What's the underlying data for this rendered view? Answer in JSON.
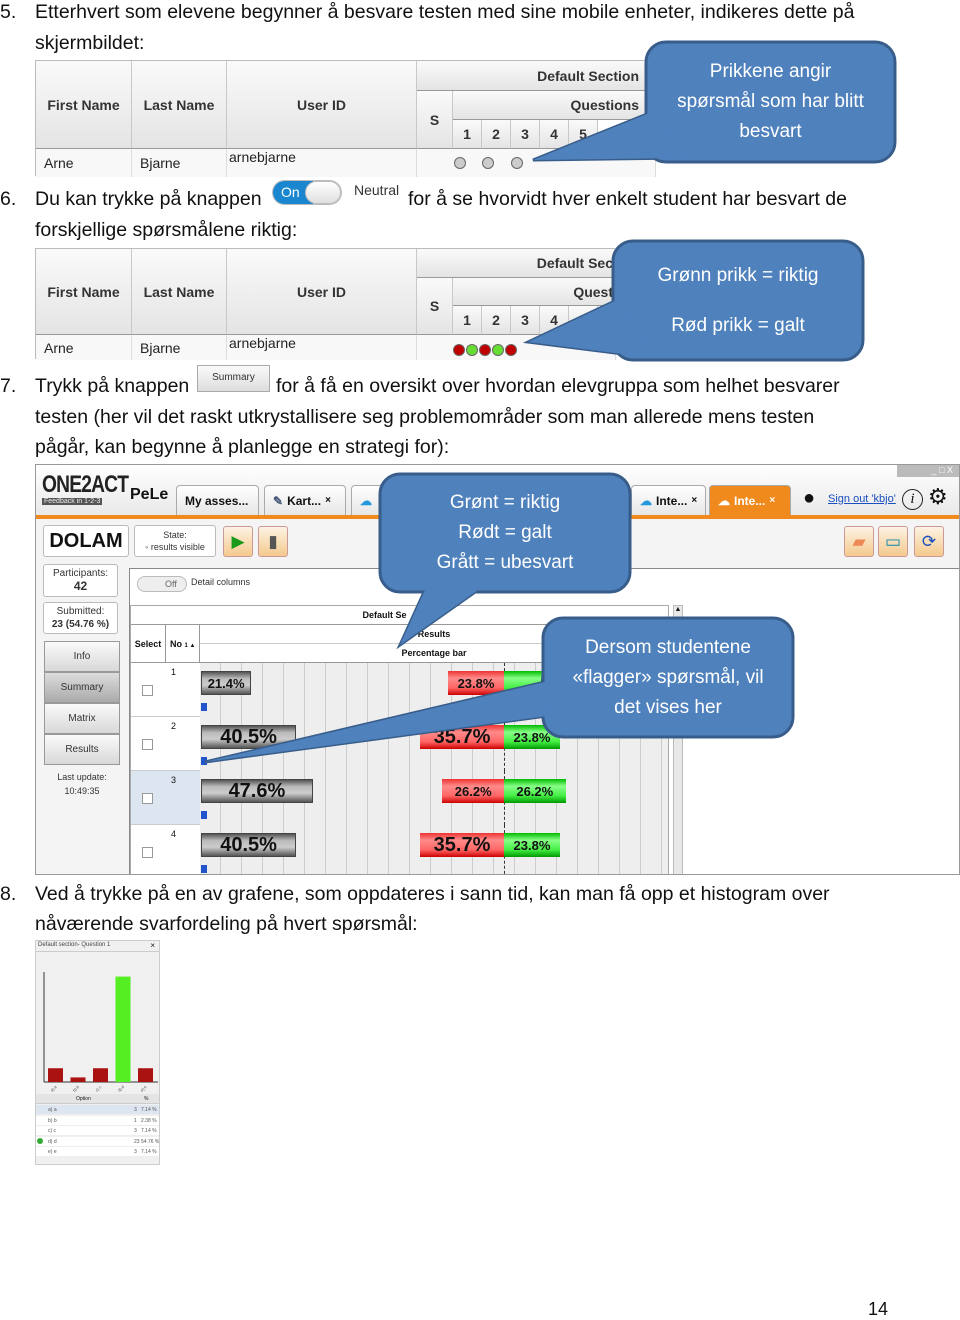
{
  "items": [
    {
      "number": "5.",
      "lines": [
        "Etterhvert som elevene begynner å besvare testen med sine mobile enheter, indikeres dette på",
        "skjermbildet:"
      ]
    },
    {
      "number": "6.",
      "lines": [
        "Du kan trykke på knappen",
        "for å se hvorvidt hver enkelt student har besvart de",
        "forskjellige spørsmålene riktig:"
      ],
      "toggle_on": "On",
      "toggle_neutral": "Neutral"
    },
    {
      "number": "7.",
      "lines": [
        "Trykk på knappen",
        "for å få en oversikt over hvordan elevgruppa som helhet besvarer",
        "testen (her vil det raskt utkrystallisere seg problemområder som man allerede mens testen",
        "pågår, kan begynne å planlegge en strategi for):"
      ],
      "button_label": "Summary"
    },
    {
      "number": "8.",
      "lines": [
        "Ved å trykke på en av grafene, som oppdateres i sann tid, kan man få opp et histogram over",
        "nåværende svarfordeling på hvert spørsmål:"
      ]
    }
  ],
  "student_table": {
    "headers": {
      "first_name": "First Name",
      "last_name": "Last Name",
      "user_id": "User ID",
      "section": "Default Section",
      "section_clipped": "Default Sec",
      "s": "S",
      "questions": "Questions",
      "questions_clipped": "Quest"
    },
    "question_numbers": [
      "1",
      "2",
      "3",
      "4",
      "5"
    ],
    "row": {
      "first_name": "Arne",
      "last_name": "Bjarne",
      "user_id": "arnebjarne"
    },
    "dots_neutral": [
      "answered",
      "answered",
      "answered"
    ],
    "dots_graded": [
      "wrong",
      "right",
      "wrong",
      "right",
      "wrong"
    ]
  },
  "callouts": {
    "c1": [
      "Prikkene angir",
      "spørsmål som har blitt",
      "besvart"
    ],
    "c2": [
      "Grønn prikk = riktig",
      "Rød prikk = galt"
    ],
    "c3": [
      "Grønt = riktig",
      "Rødt = galt",
      "Grått = ubesvart"
    ],
    "c4": [
      "Dersom studentene",
      "«flagger» spørsmål, vil",
      "det vises her"
    ]
  },
  "app": {
    "logo": "ONE2ACT",
    "logo_tagline": "Feedback in 1-2-3",
    "logo_pele": "PeLe",
    "tabs": [
      {
        "label": "My asses..."
      },
      {
        "label": "Kart...",
        "icon": "edit-icon"
      },
      {
        "label": "",
        "icon": "cloud-icon"
      },
      {
        "label": "Inte...",
        "icon": "cloud-icon"
      },
      {
        "label": "Inte...",
        "icon": "cloud-icon",
        "active": true
      }
    ],
    "sign_out": "Sign out 'kbjo'",
    "test_name": "DOLAM",
    "state_label": "State:",
    "state_value": "results visible",
    "participants_label": "Participants:",
    "participants": "42",
    "submitted_label": "Submitted:",
    "submitted": "23 (54.76 %)",
    "nav": [
      "Info",
      "Summary",
      "Matrix",
      "Results"
    ],
    "last_update_label": "Last update:",
    "last_update": "10:49:35",
    "detail_toggle": "Off",
    "detail_columns": "Detail columns",
    "grid": {
      "section": "Default Se",
      "results": "Results",
      "percentage_bar": "Percentage bar",
      "select": "Select",
      "no": "No",
      "sort": "1 ▲",
      "rows": [
        {
          "no": "1",
          "unanswered": "21.4%",
          "wrong": "23.8%",
          "right": "54.8%",
          "u": 21.4,
          "w": 23.8,
          "r": 54.8
        },
        {
          "no": "2",
          "unanswered": "40.5%",
          "wrong": "35.7%",
          "right": "23.8%",
          "u": 40.5,
          "w": 35.7,
          "r": 23.8
        },
        {
          "no": "3",
          "unanswered": "47.6%",
          "wrong": "26.2%",
          "right": "26.2%",
          "u": 47.6,
          "w": 26.2,
          "r": 26.2,
          "selected": true
        },
        {
          "no": "4",
          "unanswered": "40.5%",
          "wrong": "35.7%",
          "right": "23.8%",
          "u": 40.5,
          "w": 35.7,
          "r": 23.8
        }
      ]
    },
    "colors": {
      "accent": "#f08a1c",
      "callout": "#4f81bd",
      "right": "#22cc22",
      "wrong": "#ee3333",
      "unanswered": "#888888"
    }
  },
  "histogram": {
    "title": "Default section- Question 1",
    "close": "×",
    "columns": [
      "Option",
      "%"
    ],
    "rows": [
      {
        "option": "a) a",
        "count": "3",
        "pct": "7.14 %",
        "value": 3
      },
      {
        "option": "b) b",
        "count": "1",
        "pct": "2.38 %",
        "value": 1
      },
      {
        "option": "c) c",
        "count": "3",
        "pct": "7.14 %",
        "value": 3
      },
      {
        "option": "d) d",
        "count": "23",
        "pct": "54.76 %",
        "value": 23,
        "correct": true
      },
      {
        "option": "e) e",
        "count": "3",
        "pct": "7.14 %",
        "value": 3
      }
    ]
  },
  "page_number": "14"
}
